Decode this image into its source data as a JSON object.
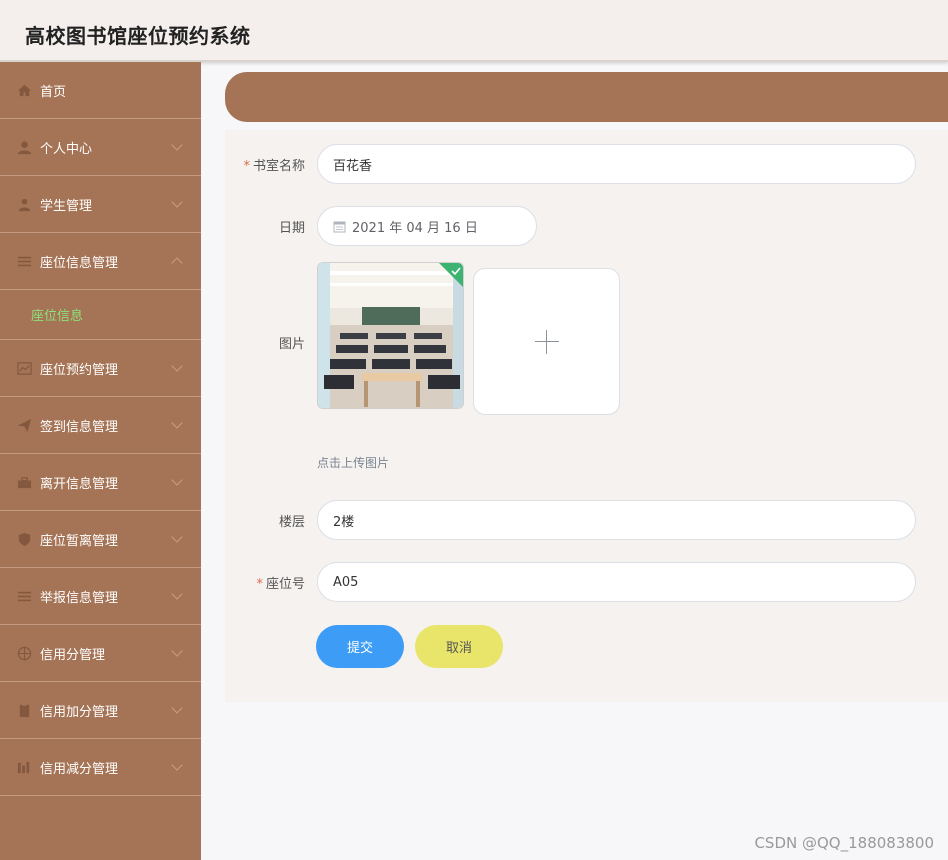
{
  "app": {
    "title": "高校图书馆座位预约系统"
  },
  "sidebar": {
    "items": [
      {
        "label": "首页",
        "icon": "home-icon"
      },
      {
        "label": "个人中心",
        "icon": "user-icon"
      },
      {
        "label": "学生管理",
        "icon": "student-icon"
      },
      {
        "label": "座位信息管理",
        "icon": "list-icon",
        "expanded": true,
        "children": [
          {
            "label": "座位信息",
            "active": true
          }
        ]
      },
      {
        "label": "座位预约管理",
        "icon": "chart-icon"
      },
      {
        "label": "签到信息管理",
        "icon": "send-icon"
      },
      {
        "label": "离开信息管理",
        "icon": "briefcase-icon"
      },
      {
        "label": "座位暂离管理",
        "icon": "shield-icon"
      },
      {
        "label": "举报信息管理",
        "icon": "menu-icon"
      },
      {
        "label": "信用分管理",
        "icon": "compass-icon"
      },
      {
        "label": "信用加分管理",
        "icon": "clipboard-icon"
      },
      {
        "label": "信用减分管理",
        "icon": "bars-icon"
      }
    ]
  },
  "form": {
    "room_name": {
      "label": "书室名称",
      "value": "百花香",
      "required": true
    },
    "date": {
      "label": "日期",
      "value": "2021 年 04 月 16 日"
    },
    "image": {
      "label": "图片",
      "hint": "点击上传图片"
    },
    "floor": {
      "label": "楼层",
      "value": "2楼"
    },
    "seat_no": {
      "label": "座位号",
      "value": "A05",
      "required": true
    },
    "submit_label": "提交",
    "cancel_label": "取消"
  },
  "watermark": "CSDN @QQ_188083800",
  "colors": {
    "sidebar": "#a57355",
    "submit": "#3d9cf5",
    "cancel": "#e8e56a",
    "active_sub": "#8de27a"
  }
}
